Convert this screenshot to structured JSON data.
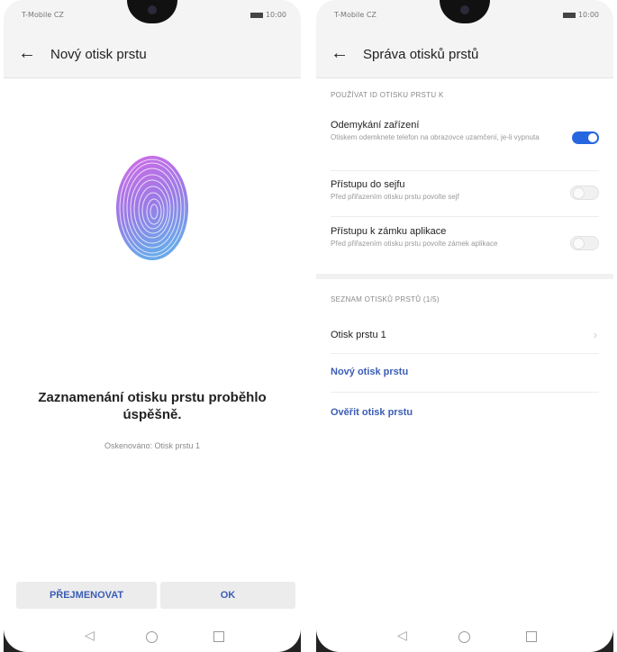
{
  "left_screen": {
    "status": {
      "carrier": "T-Mobile CZ",
      "time": "10:00"
    },
    "title": "Nový otisk prstu",
    "success_title": "Zaznamenání otisku prstu proběhlo úspěšně.",
    "success_subtitle": "Oskenováno: Otisk prstu 1",
    "buttons": {
      "rename": "PŘEJMENOVAT",
      "ok": "OK"
    }
  },
  "right_screen": {
    "status": {
      "carrier": "T-Mobile CZ",
      "time": "10:00"
    },
    "title": "Správa otisků prstů",
    "section_use": "POUŽÍVAT ID OTISKU PRSTU K",
    "settings": [
      {
        "title": "Odemykání zařízení",
        "subtitle": "Otiskem odemknete telefon na obrazovce uzamčení, je-li vypnuta",
        "enabled": true
      },
      {
        "title": "Přístupu do sejfu",
        "subtitle": "Před přiřazením otisku prstu povolte sejf",
        "enabled": false
      },
      {
        "title": "Přístupu k zámku aplikace",
        "subtitle": "Před přiřazením otisku prstu povolte zámek aplikace",
        "enabled": false
      }
    ],
    "section_list": "SEZNAM OTISKŮ PRSTŮ (1/5)",
    "fingerprints": [
      "Otisk prstu 1"
    ],
    "actions": {
      "new": "Nový otisk prstu",
      "verify": "Ověřit otisk prstu"
    }
  },
  "colors": {
    "accent": "#3a5db5",
    "toggle_on": "#2667e0",
    "fingerprint_top": "#c65be0",
    "fingerprint_bottom": "#6a9ee8"
  },
  "icons": {
    "back": "arrow-left-icon",
    "chevron": "chevron-right-icon",
    "nav_back": "triangle-back-icon",
    "nav_home": "circle-home-icon",
    "nav_recent": "square-recent-icon"
  }
}
